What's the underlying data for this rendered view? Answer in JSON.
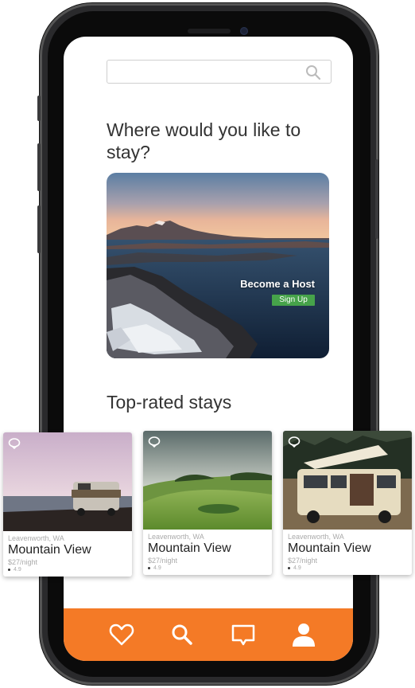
{
  "search": {
    "placeholder": ""
  },
  "headline": "Where would you like to stay?",
  "hero": {
    "title": "Become a Host",
    "button": "Sign Up"
  },
  "section_title": "Top-rated stays",
  "cards": [
    {
      "location": "Leavenworth, WA",
      "name": "Mountain View",
      "price": "$27/night",
      "rating": "4.9"
    },
    {
      "location": "Leavenworth, WA",
      "name": "Mountain View",
      "price": "$27/night",
      "rating": "4.9"
    },
    {
      "location": "Leavenworth, WA",
      "name": "Mountain View",
      "price": "$27/night",
      "rating": "4.9"
    }
  ],
  "tabbar": {
    "color": "#f47a26",
    "icons": [
      "heart-icon",
      "search-icon",
      "message-icon",
      "user-icon"
    ]
  },
  "colors": {
    "accent": "#f47a26",
    "signup": "#46a34a"
  }
}
